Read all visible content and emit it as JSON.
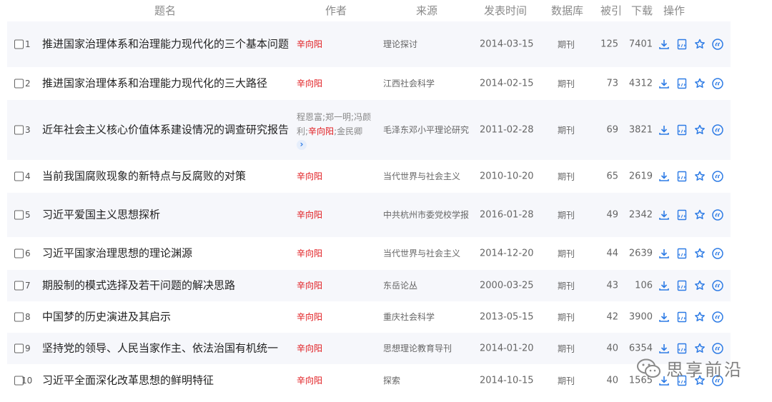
{
  "headers": {
    "title": "题名",
    "author": "作者",
    "source": "来源",
    "date": "发表时间",
    "database": "数据库",
    "cited": "被引",
    "downloads": "下载",
    "actions": "操作"
  },
  "rows": [
    {
      "no": "1",
      "title": "推进国家治理体系和治理能力现代化的三个基本问题",
      "authors": [
        {
          "t": "辛向阳",
          "h": true
        }
      ],
      "source": "理论探讨",
      "date": "2014-03-15",
      "db": "期刊",
      "cited": "125",
      "downloads": "7401"
    },
    {
      "no": "2",
      "title": "推进国家治理体系和治理能力现代化的三大路径",
      "authors": [
        {
          "t": "辛向阳",
          "h": true
        }
      ],
      "source": "江西社会科学",
      "date": "2014-02-15",
      "db": "期刊",
      "cited": "73",
      "downloads": "4312"
    },
    {
      "no": "3",
      "title": "近年社会主义核心价值体系建设情况的调查研究报告",
      "authors": [
        {
          "t": "程恩富;郑一明;冯颜利;",
          "h": false
        },
        {
          "t": "辛向阳",
          "h": true
        },
        {
          "t": ";金民卿",
          "h": false
        }
      ],
      "source": "毛泽东邓小平理论研究",
      "date": "2011-02-28",
      "db": "期刊",
      "cited": "69",
      "downloads": "3821",
      "more": "›"
    },
    {
      "no": "4",
      "title": "当前我国腐败现象的新特点与反腐败的对策",
      "authors": [
        {
          "t": "辛向阳",
          "h": true
        }
      ],
      "source": "当代世界与社会主义",
      "date": "2010-10-20",
      "db": "期刊",
      "cited": "65",
      "downloads": "2619"
    },
    {
      "no": "5",
      "title": "习近平爱国主义思想探析",
      "authors": [
        {
          "t": "辛向阳",
          "h": true
        }
      ],
      "source": "中共杭州市委党校学报",
      "date": "2016-01-28",
      "db": "期刊",
      "cited": "49",
      "downloads": "2342"
    },
    {
      "no": "6",
      "title": "习近平国家治理思想的理论渊源",
      "authors": [
        {
          "t": "辛向阳",
          "h": true
        }
      ],
      "source": "当代世界与社会主义",
      "date": "2014-12-20",
      "db": "期刊",
      "cited": "44",
      "downloads": "2639"
    },
    {
      "no": "7",
      "title": "期股制的模式选择及若干问题的解决思路",
      "authors": [
        {
          "t": "辛向阳",
          "h": true
        }
      ],
      "source": "东岳论丛",
      "date": "2000-03-25",
      "db": "期刊",
      "cited": "43",
      "downloads": "106"
    },
    {
      "no": "8",
      "title": "中国梦的历史演进及其启示",
      "authors": [
        {
          "t": "辛向阳",
          "h": true
        }
      ],
      "source": "重庆社会科学",
      "date": "2013-05-15",
      "db": "期刊",
      "cited": "42",
      "downloads": "3900"
    },
    {
      "no": "9",
      "title": "坚持党的领导、人民当家作主、依法治国有机统一",
      "authors": [
        {
          "t": "辛向阳",
          "h": true
        }
      ],
      "source": "思想理论教育导刊",
      "date": "2014-01-20",
      "db": "期刊",
      "cited": "40",
      "downloads": "6354"
    },
    {
      "no": "10",
      "title": "习近平全面深化改革思想的鲜明特征",
      "authors": [
        {
          "t": "辛向阳",
          "h": true
        }
      ],
      "source": "探索",
      "date": "2014-10-15",
      "db": "期刊",
      "cited": "40",
      "downloads": "1565"
    }
  ],
  "watermark": "思享前沿",
  "icons": [
    "download-icon",
    "html-reader-icon",
    "favorite-star-icon",
    "quote-icon"
  ],
  "colors": {
    "accent": "#2d7be5",
    "highlight_author": "#e0171b",
    "row_alt": "#f6f7fb"
  }
}
